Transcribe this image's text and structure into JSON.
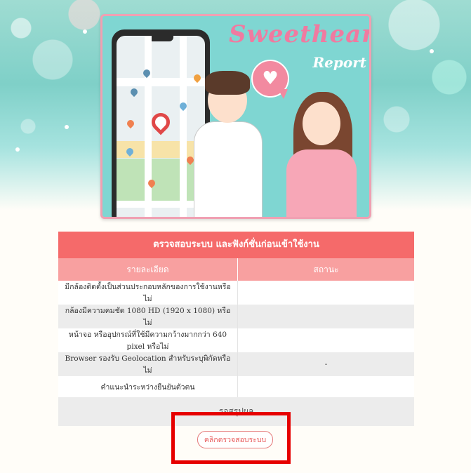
{
  "hero": {
    "title": "Sweetheart",
    "subtitle": "Report"
  },
  "check_panel": {
    "header": "ตรวจสอบระบบ และฟังก์ชั่นก่อนเข้าใช้งาน",
    "columns": [
      "รายละเอียด",
      "สถานะ"
    ],
    "rows": [
      {
        "detail": "มีกล้องติดตั้งเป็นส่วนประกอบหลักของการใช้งานหรือไม่",
        "status": ""
      },
      {
        "detail": "กล้องมีความคมชัด 1080 HD (1920 x 1080) หรือไม่",
        "status": ""
      },
      {
        "detail": "หน้าจอ หรืออุปกรณ์ที่ใช้มีความกว้างมากกว่า 640 pixel หรือไม่",
        "status": ""
      },
      {
        "detail": "Browser รองรับ Geolocation สำหรับระบุพิกัดหรือไม่",
        "status": "-"
      },
      {
        "detail": "คำแนะนำระหว่างยืนยันตัวตน",
        "status": ""
      }
    ],
    "summary": "รอสรุปผล"
  },
  "action": {
    "button_label": "คลิกตรวจสอบระบบ"
  },
  "colors": {
    "header_bg": "#f56a6a",
    "column_header_bg": "#f8a0a0",
    "highlight_border": "#e60000",
    "button_text": "#e85a5a"
  },
  "icons": [
    "map-pin-icon",
    "heart-icon"
  ]
}
